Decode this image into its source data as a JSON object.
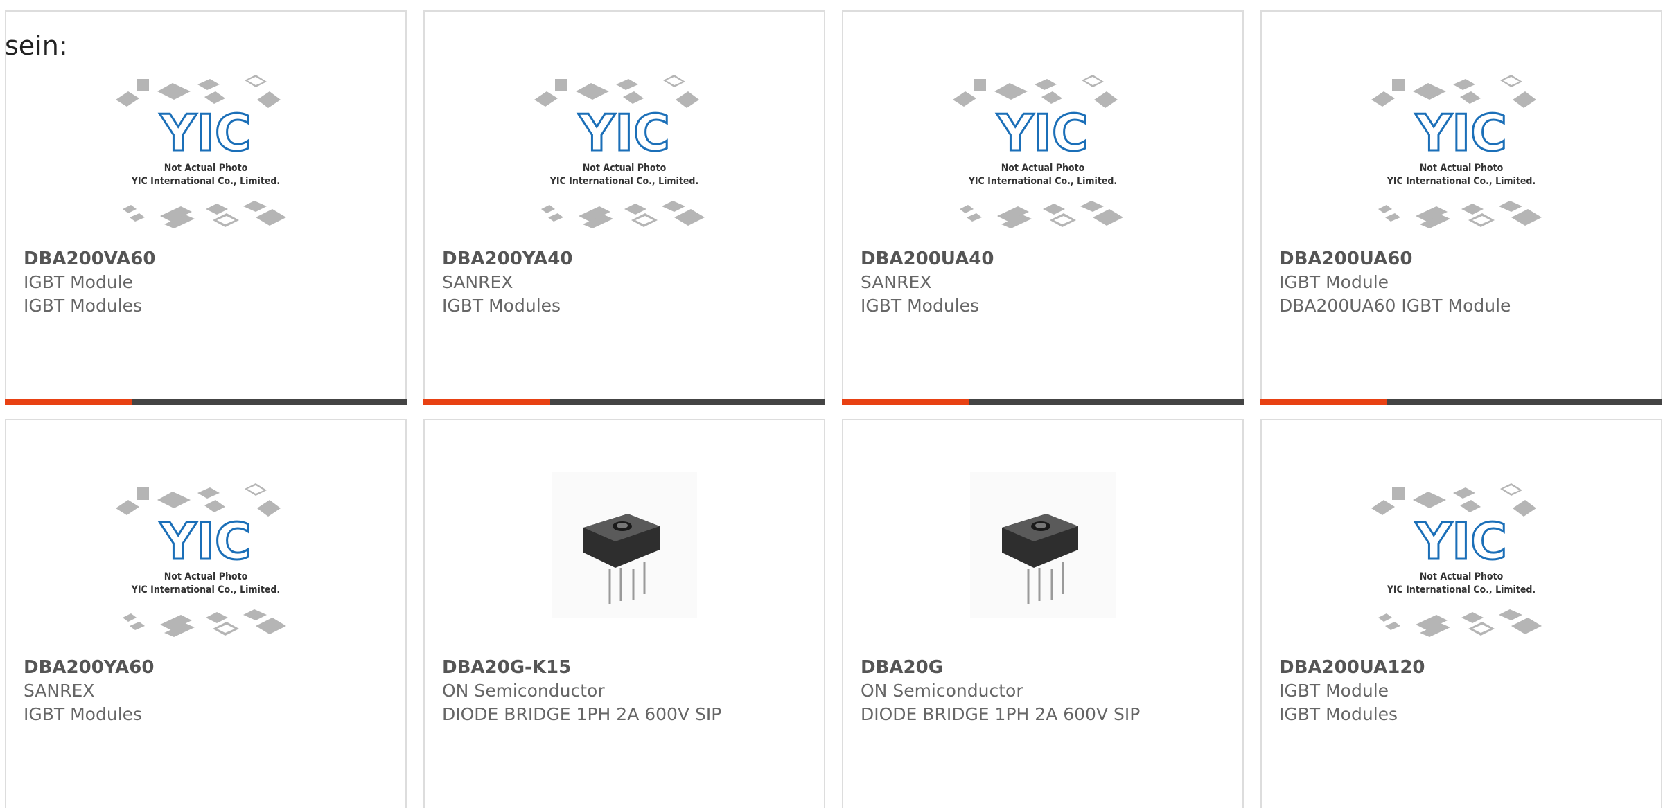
{
  "intro": {
    "text": "sein:"
  },
  "colors": {
    "accent": "#e84113",
    "bar": "#444444",
    "border": "#dddddd",
    "placeholder_blue": "#1b6fb8",
    "placeholder_gray": "#b5b5b5"
  },
  "placeholder": {
    "logo": "YIC",
    "line1": "Not Actual Photo",
    "line2": "YIC International Co., Limited."
  },
  "products": [
    {
      "part": "DBA200VA60",
      "manufacturer": "IGBT Module",
      "description": "IGBT Modules",
      "image": "placeholder"
    },
    {
      "part": "DBA200YA40",
      "manufacturer": "SANREX",
      "description": "IGBT Modules",
      "image": "placeholder"
    },
    {
      "part": "DBA200UA40",
      "manufacturer": "SANREX",
      "description": "IGBT Modules",
      "image": "placeholder"
    },
    {
      "part": "DBA200UA60",
      "manufacturer": "IGBT Module",
      "description": "DBA200UA60 IGBT Module",
      "image": "placeholder"
    },
    {
      "part": "DBA200YA60",
      "manufacturer": "SANREX",
      "description": "IGBT Modules",
      "image": "placeholder"
    },
    {
      "part": "DBA20G-K15",
      "manufacturer": "ON Semiconductor",
      "description": "DIODE BRIDGE 1PH 2A 600V SIP",
      "image": "diode-bridge-photo"
    },
    {
      "part": "DBA20G",
      "manufacturer": "ON Semiconductor",
      "description": "DIODE BRIDGE 1PH 2A 600V SIP",
      "image": "diode-bridge-photo"
    },
    {
      "part": "DBA200UA120",
      "manufacturer": "IGBT Module",
      "description": "IGBT Modules",
      "image": "placeholder"
    }
  ]
}
